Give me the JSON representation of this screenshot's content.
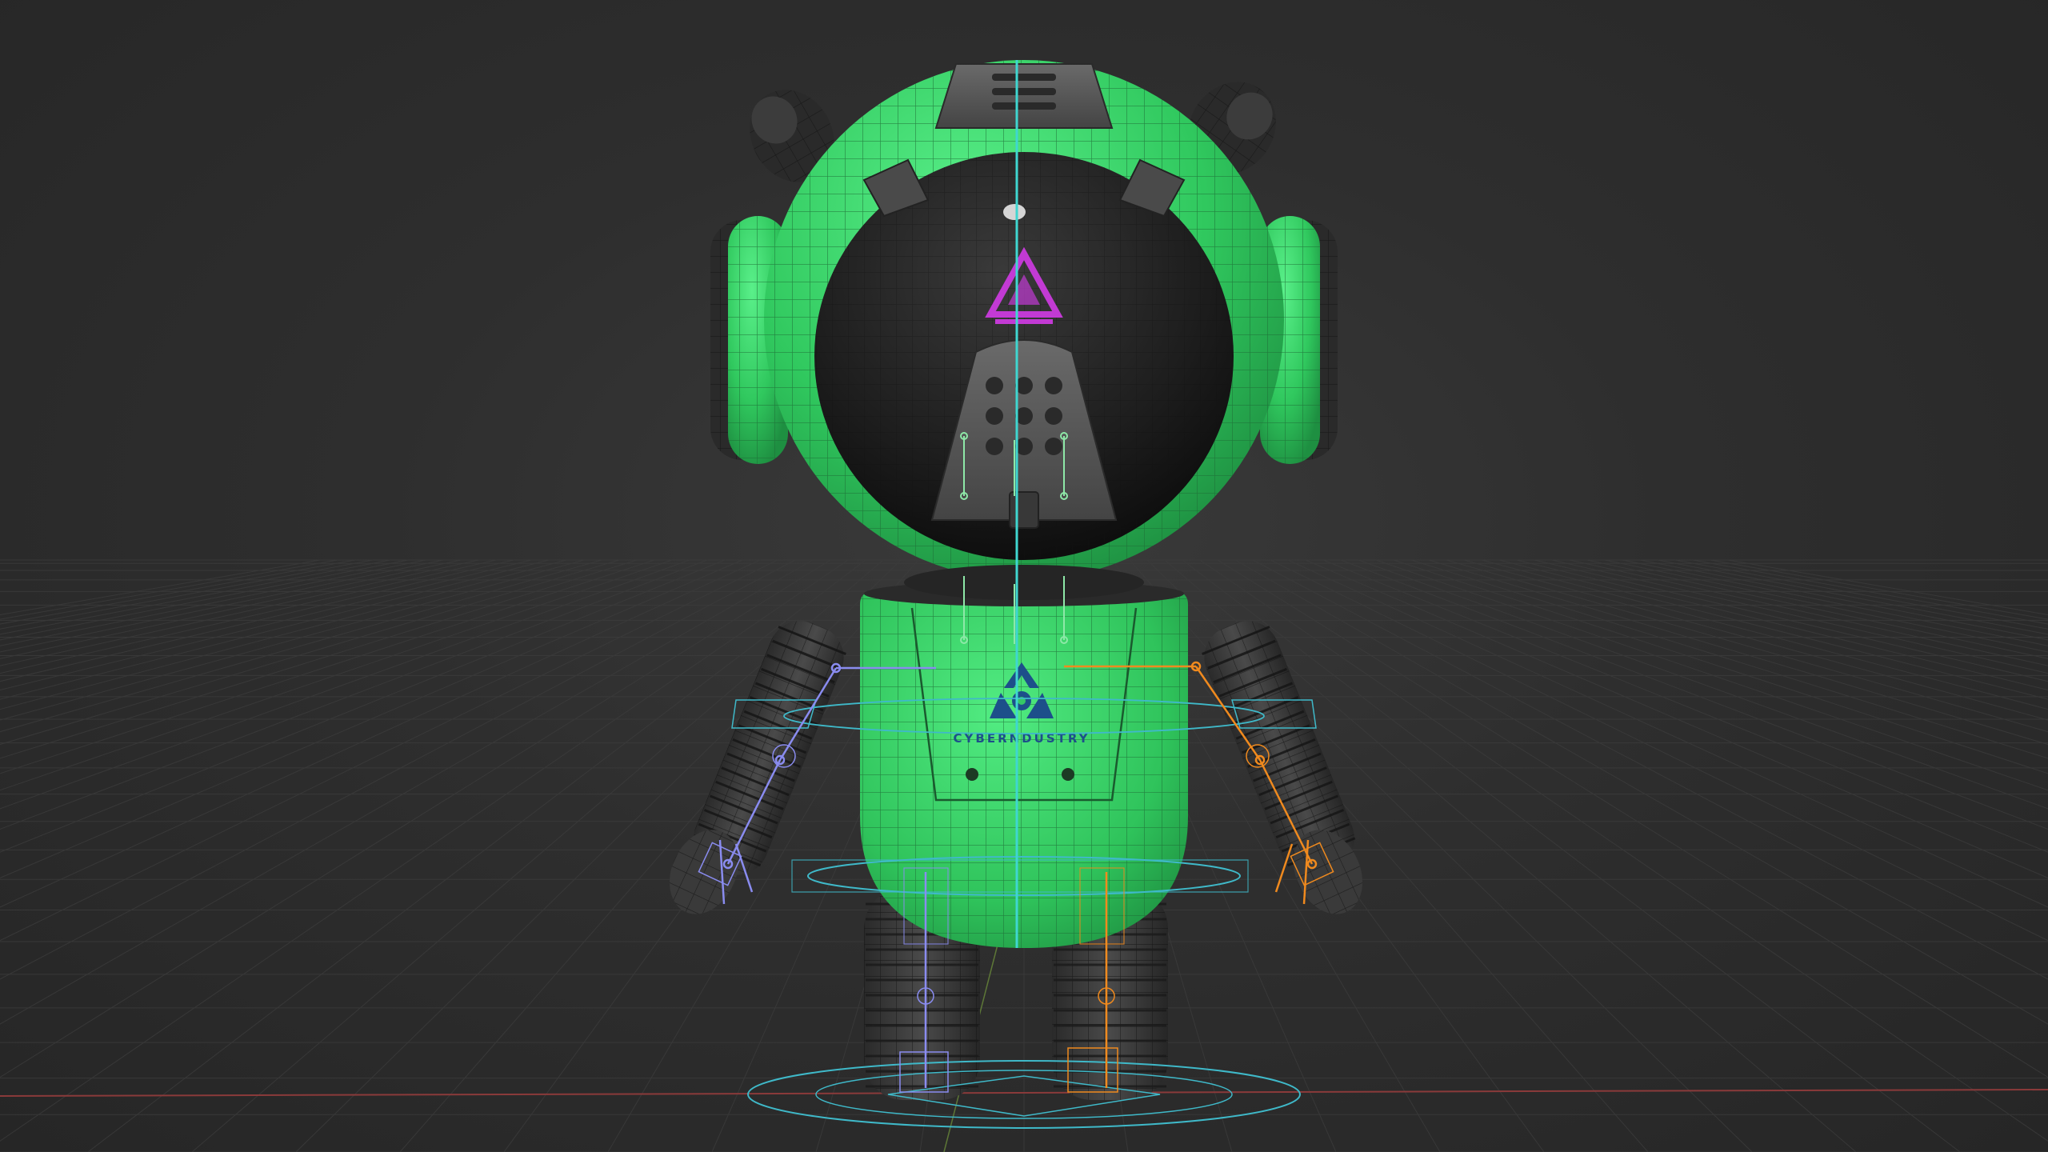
{
  "viewport": {
    "background": "#2b2b2b",
    "grid_color": "#3a3a3a",
    "x_axis_color": "#8a3a3a",
    "y_axis_color": "#6a8a3a"
  },
  "model": {
    "body_color": "#3ddc6e",
    "wire_color": "#1d6b35",
    "dark_part_color": "#2e2e2e",
    "visor_color": "#1a1a1a",
    "chest_logo_text": "CYBERNDUSTRY",
    "chest_logo_color": "#1d4f8a",
    "visor_logo_color": "#c23ad4"
  },
  "rig": {
    "center_bone_color": "#3fd6d0",
    "left_bone_color": "#8a8cf0",
    "right_bone_color": "#f08a1e",
    "control_color": "#3fb9c9"
  }
}
